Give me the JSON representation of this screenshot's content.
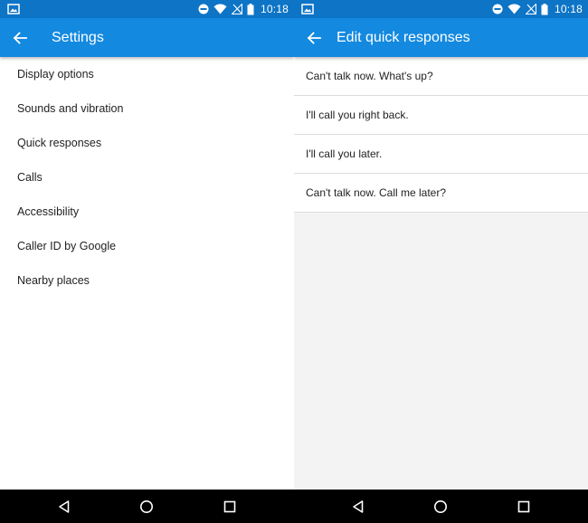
{
  "status_bar": {
    "time": "10:18"
  },
  "left_screen": {
    "title": "Settings",
    "items": [
      {
        "label": "Display options"
      },
      {
        "label": "Sounds and vibration"
      },
      {
        "label": "Quick responses"
      },
      {
        "label": "Calls"
      },
      {
        "label": "Accessibility"
      },
      {
        "label": "Caller ID by Google"
      },
      {
        "label": "Nearby places"
      }
    ]
  },
  "right_screen": {
    "title": "Edit quick responses",
    "responses": [
      {
        "text": "Can't talk now. What's up?"
      },
      {
        "text": "I'll call you right back."
      },
      {
        "text": "I'll call you later."
      },
      {
        "text": "Can't talk now. Call me later?"
      }
    ]
  },
  "icons": {
    "status_left": "image-notification-icon",
    "status_right": [
      "do-not-disturb-icon",
      "wifi-icon",
      "no-sim-icon",
      "battery-icon"
    ],
    "back": "arrow-back-icon",
    "nav": [
      "nav-back-icon",
      "nav-home-icon",
      "nav-recents-icon"
    ]
  },
  "colors": {
    "status_bar": "#0d74c6",
    "app_bar": "#1489e0",
    "nav_bar": "#000000",
    "right_background": "#f3f3f3",
    "divider": "#dcdcdc",
    "text_primary": "#222222"
  }
}
